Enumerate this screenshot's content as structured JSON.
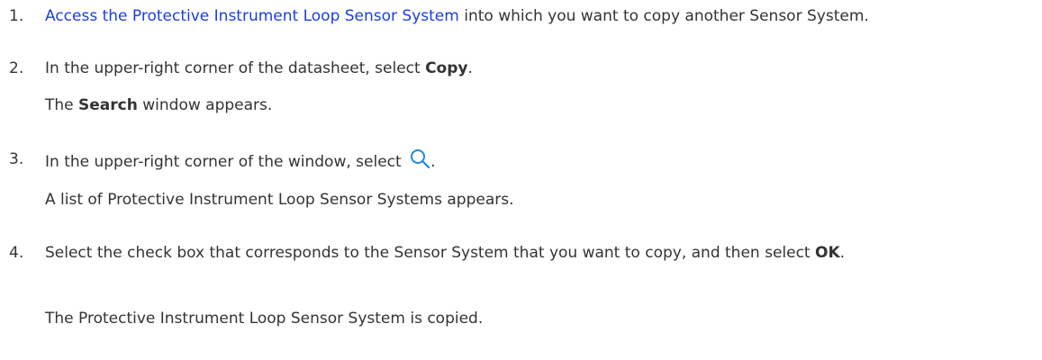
{
  "steps": [
    {
      "number": "1.",
      "link": "Access the Protective Instrument Loop Sensor System",
      "text_after": " into which you want to copy another Sensor System."
    },
    {
      "number": "2.",
      "text_before": "In the upper-right corner of the datasheet, select ",
      "bold": "Copy",
      "text_after": ".",
      "result_before": "The ",
      "result_bold": "Search",
      "result_after": " window appears."
    },
    {
      "number": "3.",
      "text_before": "In the upper-right corner of the window, select ",
      "icon": "search-icon",
      "text_after": ".",
      "result": "A list of Protective Instrument Loop Sensor Systems appears."
    },
    {
      "number": "4.",
      "text_before": "Select the check box that corresponds to the Sensor System that you want to copy, and then select ",
      "bold": "OK",
      "text_after": ".",
      "result": "The Protective Instrument Loop Sensor System is copied."
    }
  ],
  "colors": {
    "link": "#1a3fe0",
    "text": "#333333",
    "icon": "#1e88e5"
  }
}
